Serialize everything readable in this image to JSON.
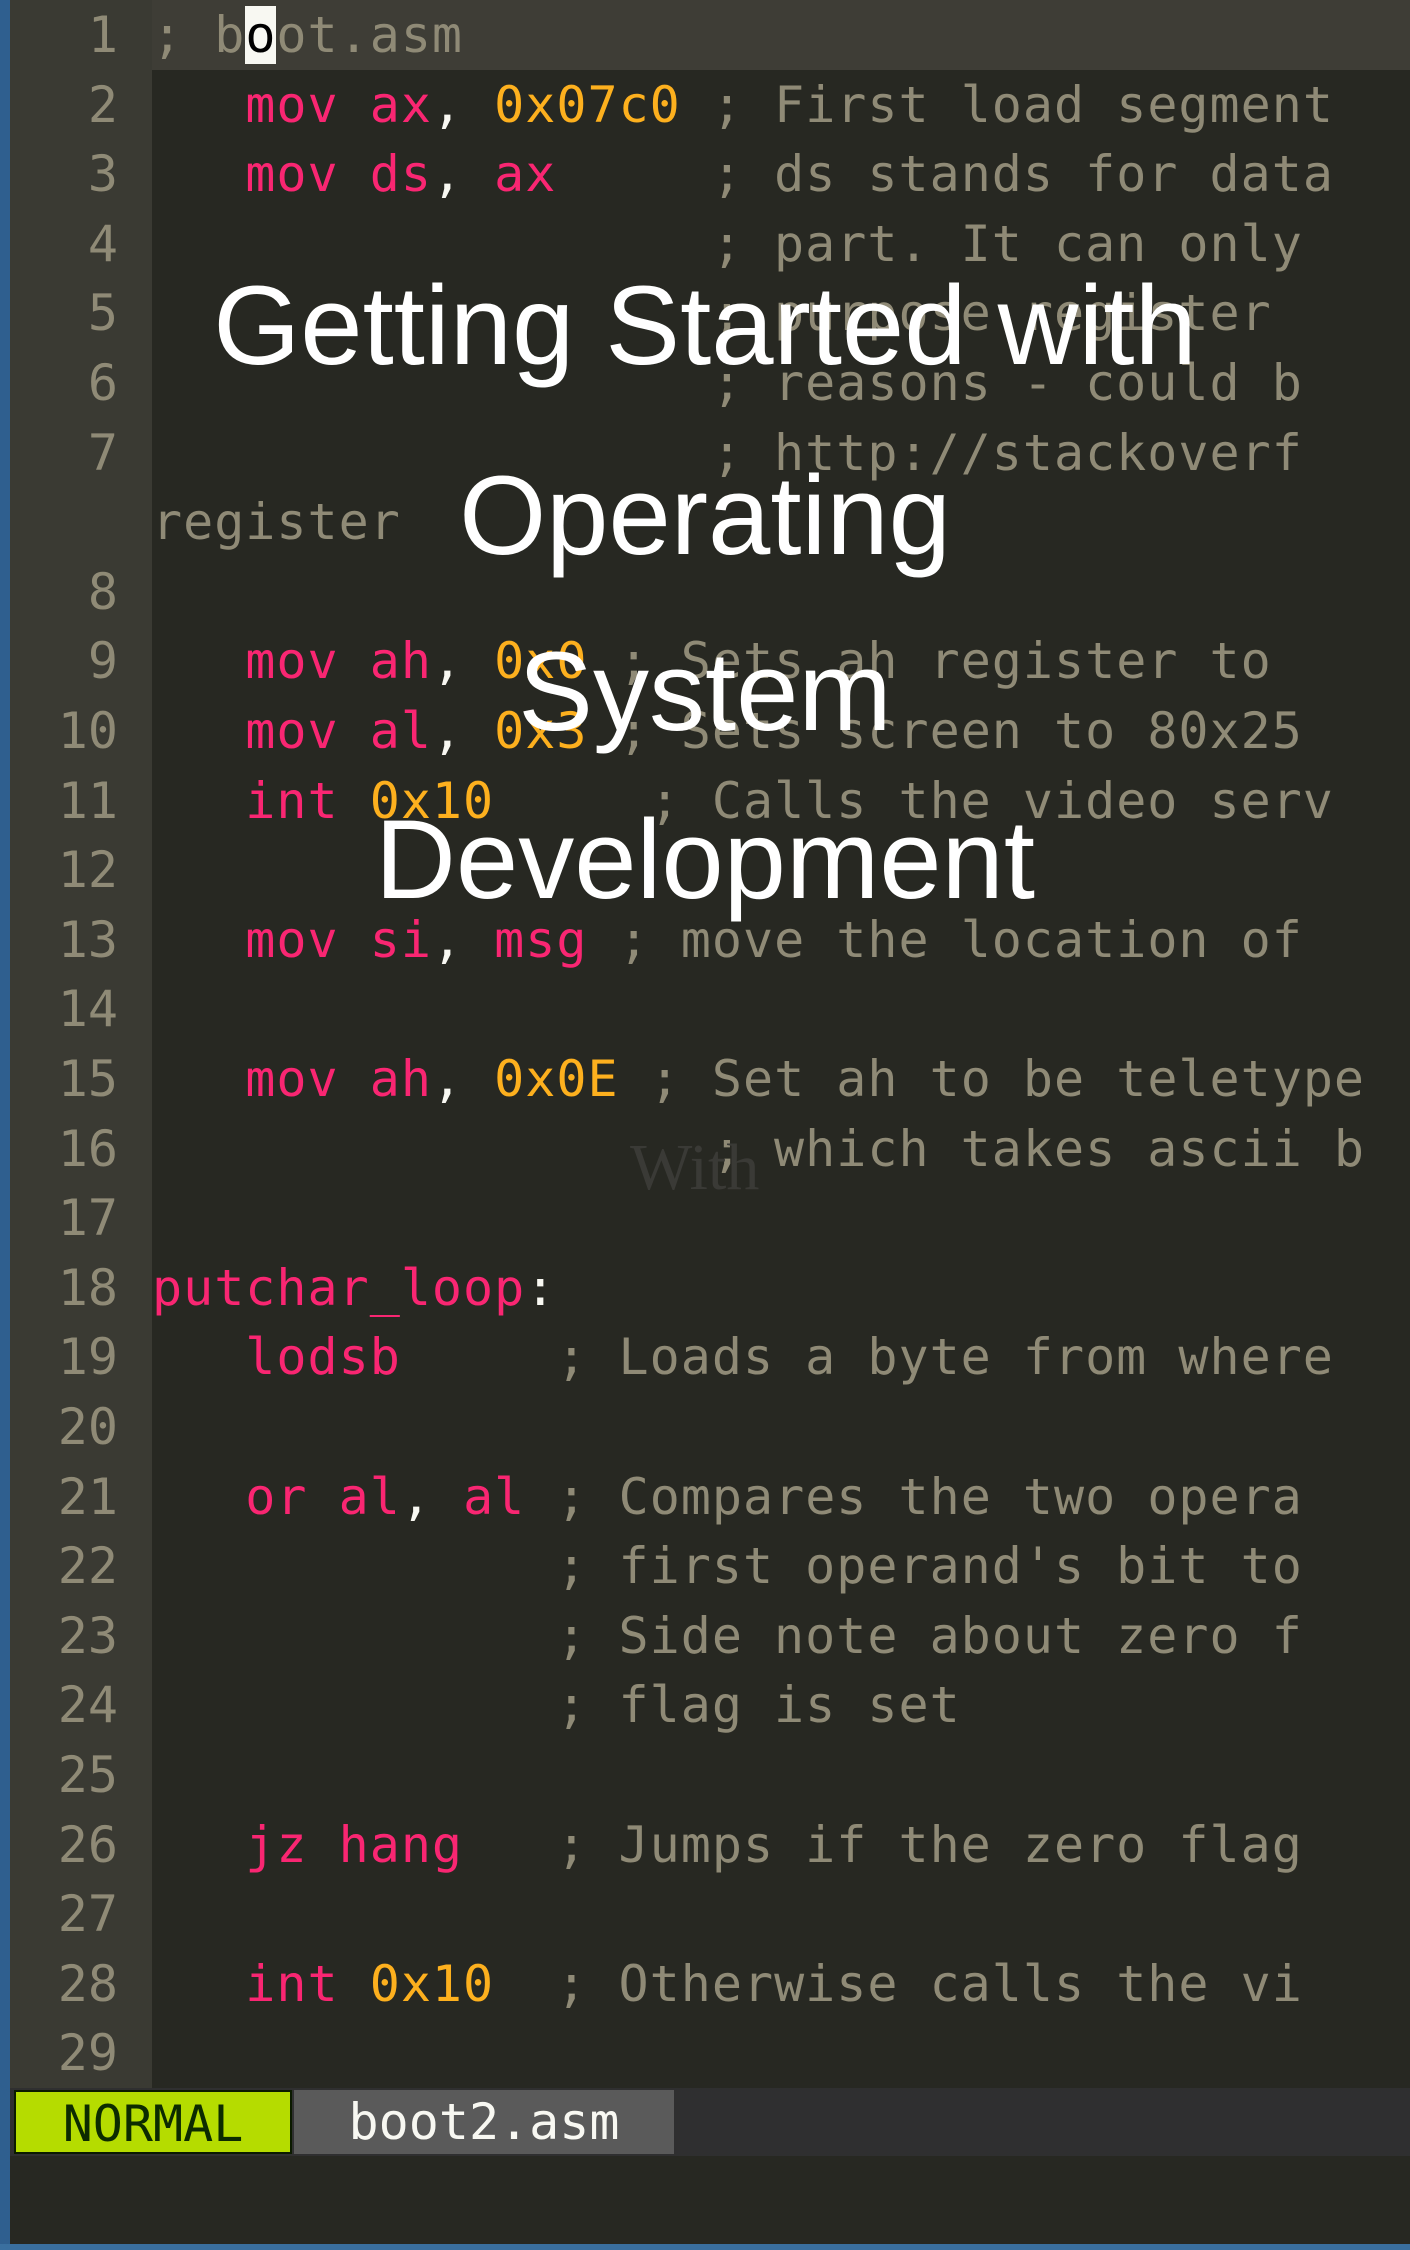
{
  "editor": {
    "lines": [
      {
        "n": "1",
        "parts": [
          [
            "cmt",
            "; b"
          ],
          [
            "cursor",
            "o"
          ],
          [
            "cmt",
            "ot.asm"
          ]
        ]
      },
      {
        "n": "2",
        "parts": [
          [
            "kw",
            "   mov "
          ],
          [
            "kw",
            "ax"
          ],
          [
            "punc",
            ", "
          ],
          [
            "num",
            "0x07c0"
          ],
          [
            "cmt",
            " ; First load segment"
          ]
        ]
      },
      {
        "n": "3",
        "parts": [
          [
            "kw",
            "   mov "
          ],
          [
            "kw",
            "ds"
          ],
          [
            "punc",
            ", "
          ],
          [
            "kw",
            "ax"
          ],
          [
            "cmt",
            "     ; ds stands for data"
          ]
        ]
      },
      {
        "n": "4",
        "parts": [
          [
            "cmt",
            "                  ; part. It can only"
          ]
        ]
      },
      {
        "n": "5",
        "parts": [
          [
            "cmt",
            "                  ; purpose register"
          ]
        ]
      },
      {
        "n": "6",
        "parts": [
          [
            "cmt",
            "                  ; reasons - could b"
          ]
        ]
      },
      {
        "n": "7",
        "parts": [
          [
            "cmt",
            "                  ; http://stackoverf"
          ]
        ]
      },
      {
        "n": "",
        "parts": [
          [
            "cmt",
            "register"
          ]
        ]
      },
      {
        "n": "8",
        "parts": []
      },
      {
        "n": "9",
        "parts": [
          [
            "kw",
            "   mov "
          ],
          [
            "kw",
            "ah"
          ],
          [
            "punc",
            ", "
          ],
          [
            "num",
            "0x0"
          ],
          [
            "cmt",
            " ; Sets ah register to"
          ]
        ]
      },
      {
        "n": "10",
        "parts": [
          [
            "kw",
            "   mov "
          ],
          [
            "kw",
            "al"
          ],
          [
            "punc",
            ", "
          ],
          [
            "num",
            "0x3"
          ],
          [
            "cmt",
            " ; Sets screen to 80x25"
          ]
        ]
      },
      {
        "n": "11",
        "parts": [
          [
            "kw",
            "   int "
          ],
          [
            "num",
            "0x10"
          ],
          [
            "cmt",
            "     ; Calls the video serv"
          ]
        ]
      },
      {
        "n": "12",
        "parts": []
      },
      {
        "n": "13",
        "parts": [
          [
            "kw",
            "   mov "
          ],
          [
            "kw",
            "si"
          ],
          [
            "punc",
            ", "
          ],
          [
            "kw",
            "msg"
          ],
          [
            "cmt",
            " ; move the location of"
          ]
        ]
      },
      {
        "n": "14",
        "parts": []
      },
      {
        "n": "15",
        "parts": [
          [
            "kw",
            "   mov "
          ],
          [
            "kw",
            "ah"
          ],
          [
            "punc",
            ", "
          ],
          [
            "num",
            "0x0E"
          ],
          [
            "cmt",
            " ; Set ah to be teletype"
          ]
        ]
      },
      {
        "n": "16",
        "parts": [
          [
            "cmt",
            "                  ; which takes ascii b"
          ]
        ]
      },
      {
        "n": "17",
        "parts": []
      },
      {
        "n": "18",
        "parts": [
          [
            "kw",
            "putchar_loop"
          ],
          [
            "punc",
            ":"
          ]
        ]
      },
      {
        "n": "19",
        "parts": [
          [
            "kw",
            "   lodsb"
          ],
          [
            "cmt",
            "     ; Loads a byte from where"
          ]
        ]
      },
      {
        "n": "20",
        "parts": []
      },
      {
        "n": "21",
        "parts": [
          [
            "kw",
            "   or "
          ],
          [
            "kw",
            "al"
          ],
          [
            "punc",
            ", "
          ],
          [
            "kw",
            "al"
          ],
          [
            "cmt",
            " ; Compares the two opera"
          ]
        ]
      },
      {
        "n": "22",
        "parts": [
          [
            "cmt",
            "             ; first operand's bit to"
          ]
        ]
      },
      {
        "n": "23",
        "parts": [
          [
            "cmt",
            "             ; Side note about zero f"
          ]
        ]
      },
      {
        "n": "24",
        "parts": [
          [
            "cmt",
            "             ; flag is set"
          ]
        ]
      },
      {
        "n": "25",
        "parts": []
      },
      {
        "n": "26",
        "parts": [
          [
            "kw",
            "   jz hang"
          ],
          [
            "cmt",
            "   ; Jumps if the zero flag"
          ]
        ]
      },
      {
        "n": "27",
        "parts": []
      },
      {
        "n": "28",
        "parts": [
          [
            "kw",
            "   int "
          ],
          [
            "num",
            "0x10"
          ],
          [
            "cmt",
            "  ; Otherwise calls the vi"
          ]
        ]
      },
      {
        "n": "29",
        "parts": []
      }
    ]
  },
  "statusbar": {
    "mode": "NORMAL",
    "filename": "boot2.asm"
  },
  "overlay": {
    "title_lines": [
      "Getting Started with",
      "Operating",
      "System",
      "Development"
    ],
    "watermark": "With"
  },
  "colors": {
    "keyword": "#f92672",
    "number": "#fdb01e",
    "comment": "#8f8a76",
    "mode_bg": "#b5dc00"
  }
}
